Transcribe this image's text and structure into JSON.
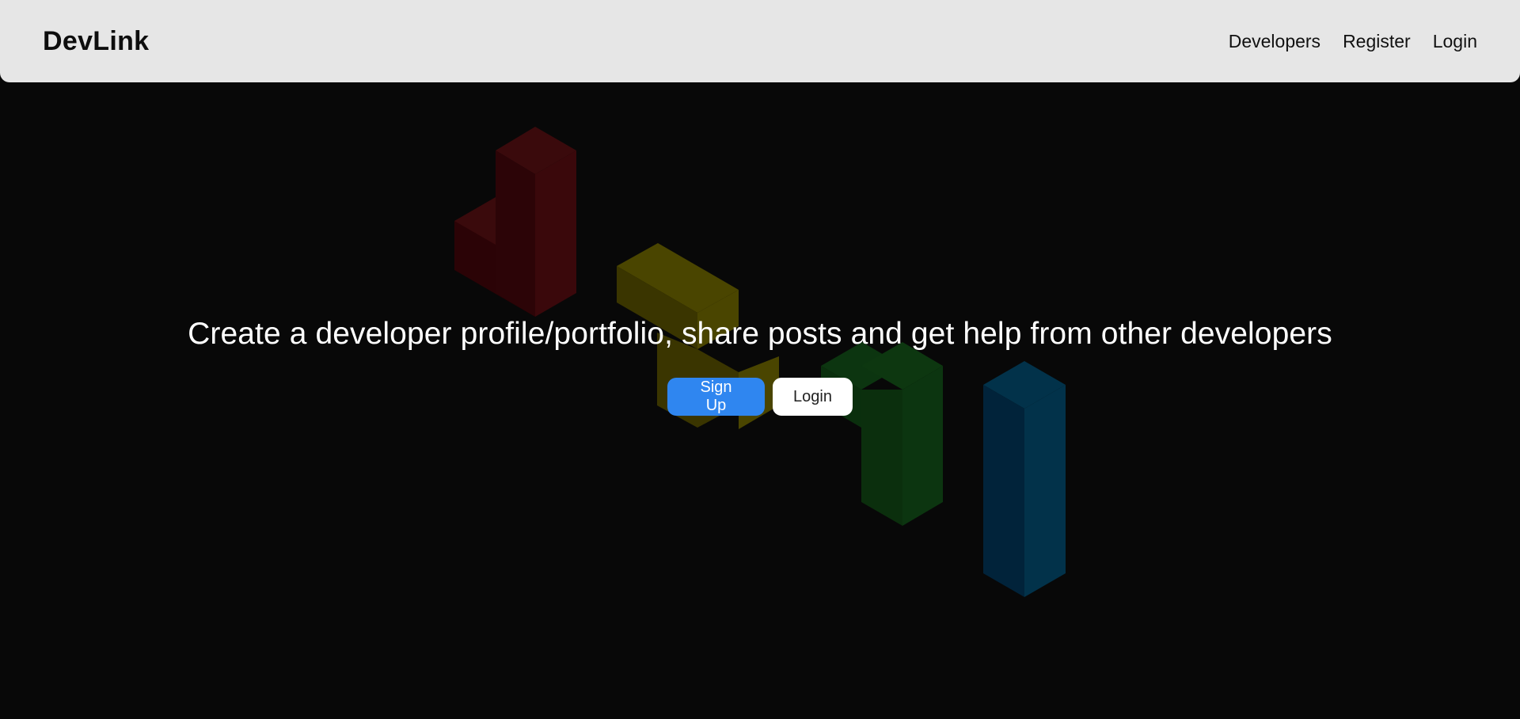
{
  "navbar": {
    "brand": "DevLink",
    "links": [
      "Developers",
      "Register",
      "Login"
    ]
  },
  "hero": {
    "tagline": "Create a developer profile/portfolio, share posts and get help from other developers",
    "primary_button": "Sign Up",
    "secondary_button": "Login"
  },
  "colors": {
    "navbar_bg": "#e6e6e6",
    "page_bg": "#080808",
    "primary_button": "#2f86f0",
    "block_red": "#3a0a0c",
    "block_yellow": "#4a4500",
    "block_green": "#0c3510",
    "block_blue": "#02324a"
  },
  "icons": [
    "red-block-shape",
    "yellow-block-shape",
    "green-block-shape",
    "blue-block-shape"
  ]
}
